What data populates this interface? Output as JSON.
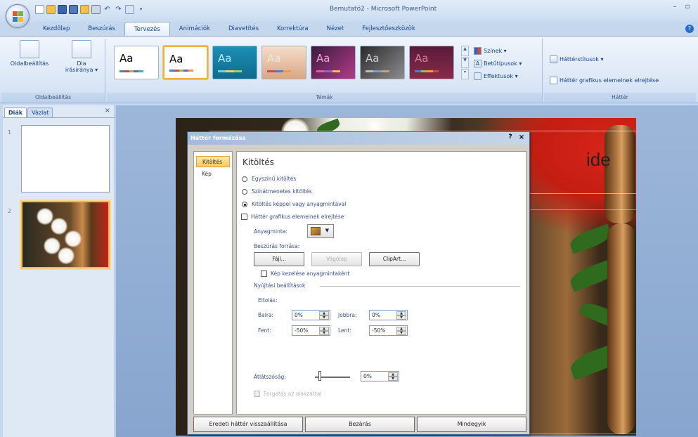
{
  "window": {
    "title": "Bemutató2 - Microsoft PowerPoint",
    "minimize": "–",
    "close": "▫",
    "help": "?"
  },
  "qat": {
    "icons": [
      "new-icon",
      "open-icon",
      "save-icon",
      "save-all-icon",
      "folder-icon",
      "print-icon",
      "undo-icon",
      "redo-icon",
      "slides-icon",
      "customize-icon"
    ]
  },
  "tabs": [
    "Kezdőlap",
    "Beszúrás",
    "Tervezés",
    "Animációk",
    "Diavetítés",
    "Korrektúra",
    "Nézet",
    "Fejlesztőeszközök"
  ],
  "active_tab": "Tervezés",
  "ribbon": {
    "page_setup_group": {
      "label": "Oldalbeállítás",
      "page_setup_btn": "Oldalbeállítás",
      "orientation_btn_line1": "Dia",
      "orientation_btn_line2": "irásiránya ▾"
    },
    "themes_group": {
      "label": "Témák",
      "theme_text": "Aa",
      "colors": "Színek ▾",
      "fonts": "Betűtípusok ▾",
      "effects": "Effektusok ▾"
    },
    "background_group": {
      "label": "Háttér",
      "styles": "Háttérstílusok ▾",
      "hide_graphics": "Háttér grafikus elemeinek elrejtése"
    }
  },
  "left_panel": {
    "tab_slides": "Diák",
    "tab_outline": "Vázlat",
    "close": "×",
    "slide1_num": "1",
    "slide2_num": "2"
  },
  "slide": {
    "title_fragment": "ide"
  },
  "dialog": {
    "title": "Háttér formázása",
    "help": "?",
    "close": "×",
    "nav": [
      "Kitöltés",
      "Kép"
    ],
    "heading": "Kitöltés",
    "fill_options": [
      {
        "label": "Egyszínű kitöltés",
        "selected": false
      },
      {
        "label": "Színátmenetes kitöltés",
        "selected": false
      },
      {
        "label": "Kitöltés képpel vagy anyagmintával",
        "selected": true
      }
    ],
    "hide_bg_graphics": "Háttér grafikus elemeinek elrejtése",
    "texture_label": "Anyagminta:",
    "insert_from_label": "Beszúrás forrása:",
    "file_btn": "Fájl...",
    "clipboard_btn": "Vágólap",
    "clipart_btn": "ClipArt...",
    "tile_checkbox": "Kép kezelése anyagmintaként",
    "stretch_options": "Nyújtási beállítások",
    "offset_label": "Eltolás:",
    "left_label": "Balra:",
    "left_value": "0%",
    "right_label": "Jobbra:",
    "right_value": "0%",
    "top_label": "Fent:",
    "top_value": "-50%",
    "bottom_label": "Lent:",
    "bottom_value": "-50%",
    "transparency_label": "Átlátszóság:",
    "transparency_value": "0%",
    "transparency_level": 0,
    "rotate_with_shape": "Forgatás az alakzattal",
    "footer": {
      "reset": "Eredeti háttér visszaállítása",
      "close": "Bezárás",
      "apply_all": "Mindegyik"
    }
  },
  "colors": {
    "accent": "#f0b23c",
    "ribbon_text": "#15428b"
  }
}
